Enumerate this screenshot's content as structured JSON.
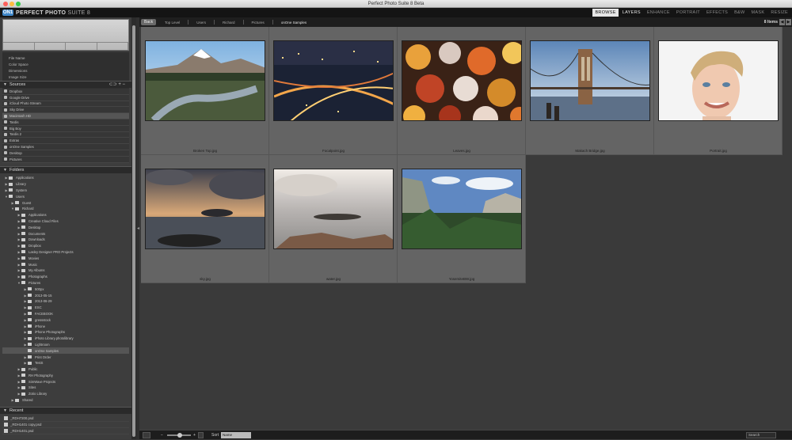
{
  "window": {
    "title": "Perfect Photo Suite 8 Beta"
  },
  "app": {
    "logo_mark": "ON1",
    "name_bold": "PERFECT PHOTO",
    "name_light": "SUITE 8",
    "modules": [
      "BROWSE",
      "LAYERS",
      "ENHANCE",
      "PORTRAIT",
      "EFFECTS",
      "B&W",
      "MASK",
      "RESIZE"
    ]
  },
  "nav": {
    "back_label": "Back",
    "crumbs": [
      "Top Level",
      "Users",
      "Richard",
      "Pictures",
      "onOne Samples"
    ],
    "count": "8 Items"
  },
  "metadata": {
    "rows": [
      "File Name",
      "Color Space",
      "Dimensions",
      "Image Size"
    ]
  },
  "sources": {
    "title": "Sources",
    "tools": "⊂⊃ + −",
    "items": [
      "Dropbox",
      "Google Drive",
      "iCloud Photo Stream",
      "Sky Drive",
      "Macintosh HD",
      "Tardis",
      "Big Boy",
      "Tardis 2",
      "Extras",
      "onOne Samples",
      "Desktop",
      "Pictures"
    ],
    "selected_index": 4
  },
  "folders": {
    "title": "Folders",
    "items": [
      {
        "label": "Applications",
        "depth": 0,
        "tri": "▶"
      },
      {
        "label": "Library",
        "depth": 0,
        "tri": "▶"
      },
      {
        "label": "System",
        "depth": 0,
        "tri": "▶"
      },
      {
        "label": "Users",
        "depth": 0,
        "tri": "▼"
      },
      {
        "label": "Guest",
        "depth": 1,
        "tri": "▶"
      },
      {
        "label": "Richard",
        "depth": 1,
        "tri": "▼"
      },
      {
        "label": "Applications",
        "depth": 2,
        "tri": "▶"
      },
      {
        "label": "Creative Cloud Files",
        "depth": 2,
        "tri": "▶"
      },
      {
        "label": "Desktop",
        "depth": 2,
        "tri": "▶"
      },
      {
        "label": "Documents",
        "depth": 2,
        "tri": "▶"
      },
      {
        "label": "Downloads",
        "depth": 2,
        "tri": "▶"
      },
      {
        "label": "Dropbox",
        "depth": 2,
        "tri": "▶"
      },
      {
        "label": "Lasley Designer PRO Projects",
        "depth": 2,
        "tri": "▶"
      },
      {
        "label": "Movies",
        "depth": 2,
        "tri": "▶"
      },
      {
        "label": "Music",
        "depth": 2,
        "tri": "▶"
      },
      {
        "label": "My Albums",
        "depth": 2,
        "tri": "▶"
      },
      {
        "label": "Photographs",
        "depth": 2,
        "tri": "▶"
      },
      {
        "label": "Pictures",
        "depth": 2,
        "tri": "▼"
      },
      {
        "label": "500px",
        "depth": 3,
        "tri": "▶"
      },
      {
        "label": "2013-05-15",
        "depth": 3,
        "tri": "▶"
      },
      {
        "label": "2013-06-29",
        "depth": 3,
        "tri": "▶"
      },
      {
        "label": "ESC",
        "depth": 3,
        "tri": "▶"
      },
      {
        "label": "FACEBOOK",
        "depth": 3,
        "tri": "▶"
      },
      {
        "label": "gressstock",
        "depth": 3,
        "tri": "▶"
      },
      {
        "label": "iPhone",
        "depth": 3,
        "tri": "▶"
      },
      {
        "label": "iPhone Photographs",
        "depth": 3,
        "tri": "▶"
      },
      {
        "label": "iPhoto Library.photolibrary",
        "depth": 3,
        "tri": "▶"
      },
      {
        "label": "Lightroom",
        "depth": 3,
        "tri": "▶"
      },
      {
        "label": "onOne Samples",
        "depth": 3,
        "tri": "",
        "selected": true
      },
      {
        "label": "Print Order",
        "depth": 3,
        "tri": "▶"
      },
      {
        "label": "TestS",
        "depth": 3,
        "tri": "▶"
      },
      {
        "label": "Public",
        "depth": 2,
        "tri": "▶"
      },
      {
        "label": "RH Photography",
        "depth": 2,
        "tri": "▶"
      },
      {
        "label": "SimWave Projects",
        "depth": 2,
        "tri": "▶"
      },
      {
        "label": "Sites",
        "depth": 2,
        "tri": "▶"
      },
      {
        "label": "Zotio Library",
        "depth": 2,
        "tri": "▶"
      },
      {
        "label": "Shared",
        "depth": 1,
        "tri": "▶"
      }
    ]
  },
  "recent": {
    "title": "Recent",
    "items": [
      "_RDH7200.psd",
      "_RDH1401 copy.psd",
      "_RDH1401.psd"
    ]
  },
  "photos": [
    {
      "name": "Broken Top.jpg",
      "art": "mountain"
    },
    {
      "name": "Focalpoint.jpg",
      "art": "city"
    },
    {
      "name": "Leaves.jpg",
      "art": "leaves"
    },
    {
      "name": "Makach Bridge.jpg",
      "art": "bridge"
    },
    {
      "name": "Portrait.jpg",
      "art": "portrait"
    },
    {
      "name": "sky.jpg",
      "art": "sky"
    },
    {
      "name": "water.jpg",
      "art": "water"
    },
    {
      "name": "YosemiteBW.jpg",
      "art": "yosemite"
    }
  ],
  "bottom": {
    "sort_label": "Sort",
    "sort_value": "Name",
    "search_placeholder": "Search"
  }
}
